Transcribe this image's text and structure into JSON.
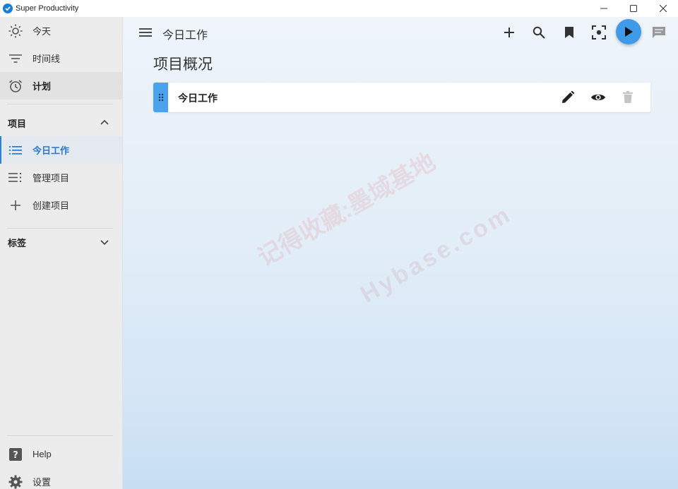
{
  "window": {
    "title": "Super Productivity"
  },
  "sidebar": {
    "nav": [
      {
        "label": "今天",
        "icon": "sun-icon"
      },
      {
        "label": "时间线",
        "icon": "filter-list-icon"
      },
      {
        "label": "计划",
        "icon": "alarm-icon"
      }
    ],
    "projects_header": "项目",
    "projects": [
      {
        "label": "今日工作",
        "icon": "list-icon"
      },
      {
        "label": "管理项目",
        "icon": "playlist-icon"
      },
      {
        "label": "创建项目",
        "icon": "plus-icon"
      }
    ],
    "tags_header": "标签",
    "footer": [
      {
        "label": "Help",
        "icon": "help-icon"
      },
      {
        "label": "设置",
        "icon": "gear-icon"
      }
    ]
  },
  "toolbar": {
    "title": "今日工作"
  },
  "main": {
    "section_title": "项目概况",
    "projects": [
      {
        "name": "今日工作"
      }
    ]
  },
  "watermark": {
    "line1": "记得收藏:墨域基地",
    "line2": "Hybase.com"
  },
  "colors": {
    "accent": "#3f9be8",
    "selected_text": "#2a78d0"
  }
}
